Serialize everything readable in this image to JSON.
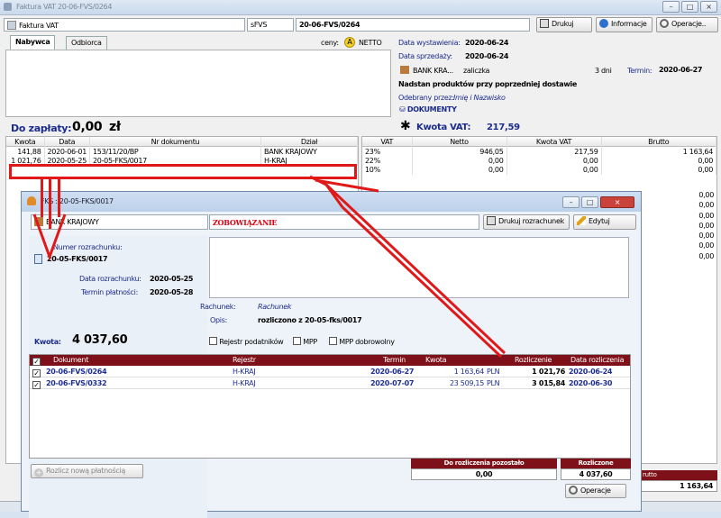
{
  "window": {
    "title": "Faktura VAT 20-06-FVS/0264"
  },
  "toolbar": {
    "doc_type": "Faktura VAT",
    "series": "sFVS",
    "number": "20-06-FVS/0264",
    "print_label": "Drukuj",
    "info_label": "Informacje",
    "ops_label": "Operacje.."
  },
  "tabs": {
    "buyer": "Nabywca",
    "receiver": "Odbiorca"
  },
  "prices": {
    "label": "ceny:",
    "badge": "A",
    "mode": "NETTO"
  },
  "details": {
    "issue_label": "Data wystawienia:",
    "issue_date": "2020-06-24",
    "sale_label": "Data sprzedaży:",
    "sale_date": "2020-06-24",
    "bank": "BANK KRA...",
    "pay_type": "zaliczka",
    "days": "3 dni",
    "due_label": "Termin:",
    "due_date": "2020-06-27",
    "description": "Nadstan produktów przy poprzedniej dostawie",
    "received_label": "Odebrany przez:",
    "received_value": "Imię i Nazwisko",
    "documents": "DOKUMENTY"
  },
  "totals": {
    "due_label": "Do zapłaty:",
    "due_amount": "0,00",
    "currency": "zł",
    "vat_label": "Kwota VAT:",
    "vat_amount": "217,59"
  },
  "payments": {
    "headers": [
      "Kwota",
      "Data",
      "Nr dokumentu",
      "Dział"
    ],
    "rows": [
      [
        "141,88",
        "2020-06-01",
        "153/11/20/BP",
        "BANK KRAJOWY"
      ],
      [
        "1 021,76",
        "2020-05-25",
        "20-05-FKS/0017",
        "H-KRAJ"
      ]
    ]
  },
  "vat_table": {
    "headers": [
      "VAT",
      "Netto",
      "Kwota VAT",
      "Brutto"
    ],
    "rows": [
      [
        "23%",
        "946,05",
        "217,59",
        "1 163,64"
      ],
      [
        "22%",
        "0,00",
        "0,00",
        "0,00"
      ],
      [
        "10%",
        "0,00",
        "0,00",
        "0,00"
      ]
    ],
    "brutto_extra": [
      "0,00",
      "0,00",
      "0,00",
      "0,00",
      "0,00",
      "0,00",
      "0,00"
    ],
    "footer_label": "rutto",
    "footer_value": "1 163,64"
  },
  "dialog": {
    "title": "FKS : 20-05-FKS/0017",
    "bank": "BANK KRAJOWY",
    "status": "ZOBOWIĄZANIE",
    "print_label": "Drukuj rozrachunek",
    "edit_label": "Edytuj",
    "number_label": "Numer rozrachunku:",
    "number": "20-05-FKS/0017",
    "settle_date_label": "Data rozrachunku:",
    "settle_date": "2020-05-25",
    "pay_term_label": "Termin płatności:",
    "pay_term": "2020-05-28",
    "account_label": "Rachunek:",
    "account_value": "Rachunek",
    "desc_label": "Opis:",
    "desc_value": "rozliczono z 20-05-fks/0017",
    "amount_label": "Kwota:",
    "amount": "4 037,60",
    "chk_vat": "Rejestr podatników",
    "chk_mpp": "MPP",
    "chk_mpp_vol": "MPP dobrowolny",
    "grid_headers": [
      "Dokument",
      "Rejestr",
      "Termin",
      "Kwota",
      "Rozliczenie",
      "Data rozliczenia"
    ],
    "grid_rows": [
      [
        "20-06-FVS/0264",
        "H-KRAJ",
        "2020-06-27",
        "1 163,64",
        "PLN",
        "1 021,76",
        "2020-06-24"
      ],
      [
        "20-06-FVS/0332",
        "H-KRAJ",
        "2020-07-07",
        "23 509,15",
        "PLN",
        "3 015,84",
        "2020-06-30"
      ]
    ],
    "new_payment": "Rozlicz nową płatnością",
    "remaining_label": "Do rozliczenia pozostało",
    "remaining": "0,00",
    "settled_label": "Rozliczone",
    "settled": "4 037,60",
    "ops_label": "Operacje"
  },
  "colors": {
    "accent": "#7d1018",
    "annotation": "#e01818",
    "link_blue": "#1e2f93"
  }
}
